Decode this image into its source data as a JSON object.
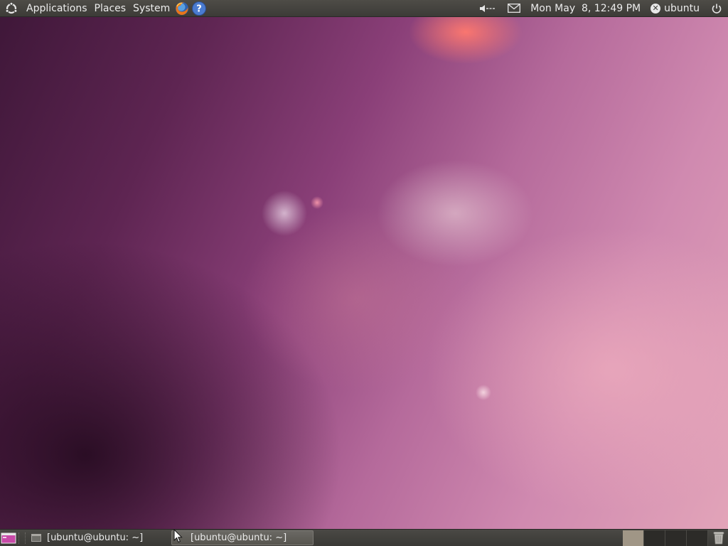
{
  "top_panel": {
    "menus": [
      "Applications",
      "Places",
      "System"
    ],
    "clock": "Mon May  8, 12:49 PM",
    "user": "ubuntu",
    "launchers": [
      "firefox-icon",
      "help-icon"
    ],
    "tray": [
      "volume-icon",
      "mail-icon",
      "power-icon"
    ]
  },
  "bottom_panel": {
    "tasks": [
      {
        "label": "[ubuntu@ubuntu: ~]",
        "active": false
      },
      {
        "label": "[ubuntu@ubuntu: ~]",
        "active": true
      }
    ],
    "workspaces": {
      "count": 4,
      "active": 1
    }
  },
  "colors": {
    "panel": "#3c3b37",
    "panel_text": "#ececec",
    "wallpaper_dark": "#3e1738",
    "wallpaper_light": "#e3a5b9",
    "active_workspace": "#a09686"
  }
}
